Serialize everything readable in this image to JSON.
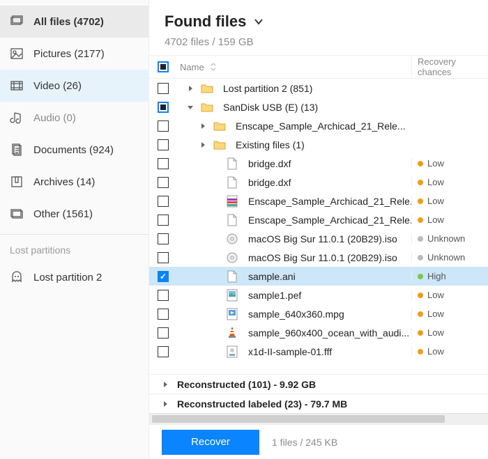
{
  "sidebar": {
    "items": [
      {
        "label": "All files (4702)",
        "icon": "all",
        "state": "selected"
      },
      {
        "label": "Pictures (2177)",
        "icon": "pictures"
      },
      {
        "label": "Video (26)",
        "icon": "video",
        "state": "highlight"
      },
      {
        "label": "Audio (0)",
        "icon": "audio",
        "muted": true
      },
      {
        "label": "Documents (924)",
        "icon": "documents"
      },
      {
        "label": "Archives (14)",
        "icon": "archives"
      },
      {
        "label": "Other (1561)",
        "icon": "other"
      }
    ],
    "section_label": "Lost partitions",
    "lost": [
      {
        "label": "Lost partition 2",
        "icon": "ghost"
      }
    ]
  },
  "header": {
    "title": "Found files",
    "subtitle": "4702 files / 159 GB"
  },
  "columns": {
    "name": "Name",
    "recovery": "Recovery chances"
  },
  "rows": [
    {
      "check": "none",
      "indent": 0,
      "arrow": "right",
      "icon": "folder",
      "name": "Lost partition 2 (851)"
    },
    {
      "check": "partial-blue",
      "indent": 0,
      "arrow": "down",
      "icon": "folder",
      "name": "SanDisk USB (E) (13)"
    },
    {
      "check": "none",
      "indent": 1,
      "arrow": "right",
      "icon": "folder",
      "name": "Enscape_Sample_Archicad_21_Rele..."
    },
    {
      "check": "none",
      "indent": 1,
      "arrow": "right",
      "icon": "folder",
      "name": "Existing files (1)"
    },
    {
      "check": "none",
      "indent": 2,
      "icon": "file",
      "name": "bridge.dxf",
      "recovery": "Low",
      "dot": "low"
    },
    {
      "check": "none",
      "indent": 2,
      "icon": "file",
      "name": "bridge.dxf",
      "recovery": "Low",
      "dot": "low"
    },
    {
      "check": "none",
      "indent": 2,
      "icon": "rar",
      "name": "Enscape_Sample_Archicad_21_Rele...",
      "recovery": "Low",
      "dot": "low"
    },
    {
      "check": "none",
      "indent": 2,
      "icon": "file",
      "name": "Enscape_Sample_Archicad_21_Rele...",
      "recovery": "Low",
      "dot": "low"
    },
    {
      "check": "none",
      "indent": 2,
      "icon": "iso",
      "name": "macOS Big Sur 11.0.1 (20B29).iso",
      "recovery": "Unknown",
      "dot": "unknown"
    },
    {
      "check": "none",
      "indent": 2,
      "icon": "iso",
      "name": "macOS Big Sur 11.0.1 (20B29).iso",
      "recovery": "Unknown",
      "dot": "unknown"
    },
    {
      "check": "checked",
      "indent": 2,
      "icon": "file",
      "name": "sample.ani",
      "recovery": "High",
      "dot": "high",
      "selected": true
    },
    {
      "check": "none",
      "indent": 2,
      "icon": "image",
      "name": "sample1.pef",
      "recovery": "Low",
      "dot": "low"
    },
    {
      "check": "none",
      "indent": 2,
      "icon": "video",
      "name": "sample_640x360.mpg",
      "recovery": "Low",
      "dot": "low"
    },
    {
      "check": "none",
      "indent": 2,
      "icon": "vlc",
      "name": "sample_960x400_ocean_with_audi...",
      "recovery": "Low",
      "dot": "low"
    },
    {
      "check": "none",
      "indent": 2,
      "icon": "fff",
      "name": "x1d-II-sample-01.fff",
      "recovery": "Low",
      "dot": "low"
    }
  ],
  "summaries": [
    {
      "label": "Reconstructed (101) - 9.92 GB"
    },
    {
      "label": "Reconstructed labeled (23) - 79.7 MB"
    }
  ],
  "footer": {
    "button": "Recover",
    "status": "1 files / 245 KB"
  }
}
